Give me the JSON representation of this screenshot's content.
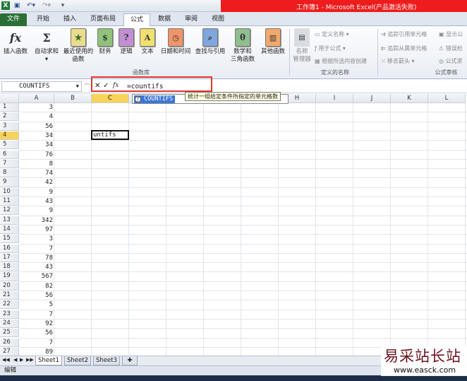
{
  "window": {
    "title": "工作簿1 - Microsoft Excel(产品激活失败)"
  },
  "tabs": [
    {
      "label": "文件"
    },
    {
      "label": "开始"
    },
    {
      "label": "插入"
    },
    {
      "label": "页面布局"
    },
    {
      "label": "公式"
    },
    {
      "label": "数据"
    },
    {
      "label": "审阅"
    },
    {
      "label": "视图"
    }
  ],
  "ribbon": {
    "insert_function": "插入函数",
    "autosum": "自动求和",
    "recent_1": "最近使用的",
    "recent_2": "函数",
    "financial": "财务",
    "logical": "逻辑",
    "text": "文本",
    "datetime": "日期和时间",
    "lookup": "查找与引用",
    "math_1": "数学和",
    "math_2": "三角函数",
    "other": "其他函数",
    "group_library": "函数库",
    "name_mgr_1": "名称",
    "name_mgr_2": "管理器",
    "define_name": "定义名称",
    "use_in_formula": "用于公式",
    "create_from_sel": "根据所选内容创建",
    "group_names": "定义的名称",
    "trace_precedents": "追踪引用单元格",
    "trace_dependents": "追踪从属单元格",
    "remove_arrows": "移去箭头",
    "show_formulas": "显示公",
    "error_check": "错误检",
    "evaluate": "公式求",
    "group_audit": "公式审核"
  },
  "formula_bar": {
    "name_box": "COUNTIFS",
    "formula": "=countifs",
    "cancel": "✕",
    "enter": "✓",
    "fx": "fx"
  },
  "autocomplete": {
    "item": "COUNTIFS",
    "tooltip": "统计一组给定条件所指定的单元格数"
  },
  "grid": {
    "columns": [
      "A",
      "B",
      "C",
      "D",
      "E",
      "F",
      "G",
      "H",
      "I",
      "J",
      "K",
      "L"
    ],
    "selected_column": "C",
    "selected_row": 4,
    "editing_cell_text": "untifs",
    "rows": [
      {
        "n": "1",
        "a": "3"
      },
      {
        "n": "2",
        "a": "4"
      },
      {
        "n": "3",
        "a": "56"
      },
      {
        "n": "4",
        "a": "34"
      },
      {
        "n": "5",
        "a": "34"
      },
      {
        "n": "6",
        "a": "76"
      },
      {
        "n": "7",
        "a": "8"
      },
      {
        "n": "8",
        "a": "74"
      },
      {
        "n": "9",
        "a": "42"
      },
      {
        "n": "10",
        "a": "9"
      },
      {
        "n": "11",
        "a": "43"
      },
      {
        "n": "12",
        "a": "9"
      },
      {
        "n": "13",
        "a": "342"
      },
      {
        "n": "14",
        "a": "97"
      },
      {
        "n": "15",
        "a": "3"
      },
      {
        "n": "16",
        "a": "7"
      },
      {
        "n": "17",
        "a": "78"
      },
      {
        "n": "18",
        "a": "43"
      },
      {
        "n": "19",
        "a": "567"
      },
      {
        "n": "20",
        "a": "82"
      },
      {
        "n": "21",
        "a": "56"
      },
      {
        "n": "22",
        "a": "5"
      },
      {
        "n": "23",
        "a": "7"
      },
      {
        "n": "24",
        "a": "92"
      },
      {
        "n": "25",
        "a": "56"
      },
      {
        "n": "26",
        "a": "7"
      },
      {
        "n": "27",
        "a": "89"
      }
    ]
  },
  "sheets": [
    {
      "label": "Sheet1"
    },
    {
      "label": "Sheet2"
    },
    {
      "label": "Sheet3"
    }
  ],
  "status": {
    "mode": "编辑"
  },
  "watermark": {
    "line1": "易采站长站",
    "line2": "www.easck.com"
  }
}
